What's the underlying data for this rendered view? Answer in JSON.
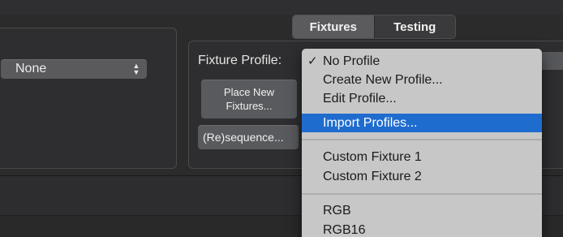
{
  "left_panel": {
    "popup_value": "None"
  },
  "tabs": [
    {
      "label": "Fixtures",
      "selected": true
    },
    {
      "label": "Testing",
      "selected": false
    }
  ],
  "fixture_profile": {
    "label": "Fixture Profile:"
  },
  "buttons": {
    "place_new_line1": "Place New",
    "place_new_line2": "Fixtures...",
    "resequence": "(Re)sequence..."
  },
  "menu": {
    "check_glyph": "✓",
    "items": [
      {
        "label": "No Profile",
        "checked": true,
        "highlighted": false
      },
      {
        "label": "Create New Profile...",
        "checked": false,
        "highlighted": false
      },
      {
        "label": "Edit Profile...",
        "checked": false,
        "highlighted": false
      },
      {
        "label": "Import Profiles...",
        "checked": false,
        "highlighted": true
      },
      {
        "label": "Custom Fixture 1",
        "checked": false,
        "highlighted": false
      },
      {
        "label": "Custom Fixture 2",
        "checked": false,
        "highlighted": false
      },
      {
        "label": "RGB",
        "checked": false,
        "highlighted": false
      },
      {
        "label": "RGB16",
        "checked": false,
        "highlighted": false
      }
    ]
  },
  "colors": {
    "highlight": "#1f6ccf",
    "menu_background": "#c7c7c8",
    "window_background": "#2b2b2c"
  },
  "icons": {
    "popup_stepper": "up-down-chevron-icon",
    "checkmark": "checkmark-icon"
  }
}
